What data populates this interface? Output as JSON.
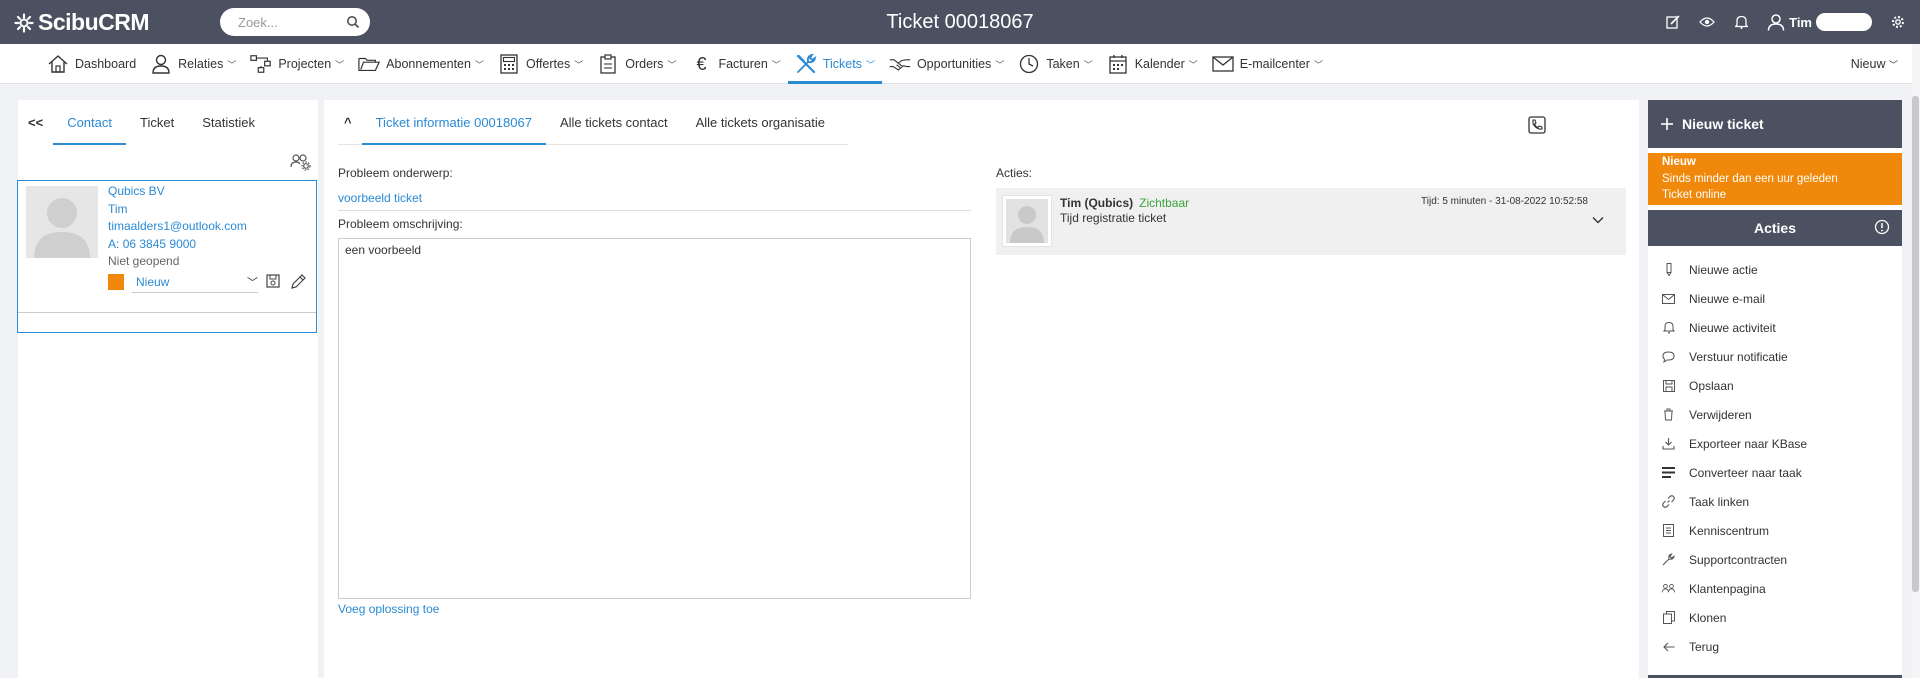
{
  "app": {
    "brand": "ScibuCRM",
    "page_title": "Ticket 00018067"
  },
  "search": {
    "placeholder": "Zoek..."
  },
  "user": {
    "name": "Tim"
  },
  "menu": {
    "items": [
      {
        "label": "Dashboard",
        "icon": "home-icon",
        "dropdown": false
      },
      {
        "label": "Relaties",
        "icon": "person-icon",
        "dropdown": true
      },
      {
        "label": "Projecten",
        "icon": "project-icon",
        "dropdown": true
      },
      {
        "label": "Abonnementen",
        "icon": "folder-icon",
        "dropdown": true
      },
      {
        "label": "Offertes",
        "icon": "calculator-icon",
        "dropdown": true
      },
      {
        "label": "Orders",
        "icon": "clipboard-icon",
        "dropdown": true
      },
      {
        "label": "Facturen",
        "icon": "euro-icon",
        "dropdown": true
      },
      {
        "label": "Tickets",
        "icon": "tools-icon",
        "dropdown": true,
        "active": true
      },
      {
        "label": "Opportunities",
        "icon": "handshake-icon",
        "dropdown": true
      },
      {
        "label": "Taken",
        "icon": "clock-icon",
        "dropdown": true
      },
      {
        "label": "Kalender",
        "icon": "calendar-icon",
        "dropdown": true
      },
      {
        "label": "E-mailcenter",
        "icon": "mail-icon",
        "dropdown": true
      }
    ],
    "nieuw": "Nieuw"
  },
  "left": {
    "back": "<<",
    "tabs": [
      "Contact",
      "Ticket",
      "Statistiek"
    ],
    "contact": {
      "company": "Qubics BV",
      "name": "Tim",
      "email": "timaalders1@outlook.com",
      "phone_prefix": "A:",
      "phone": "06 3845 9000",
      "opened": "Niet geopend",
      "status": "Nieuw",
      "status_color": "#f0890b"
    }
  },
  "middle": {
    "caret": "^",
    "tabs": [
      "Ticket informatie 00018067",
      "Alle tickets contact",
      "Alle tickets organisatie"
    ],
    "subject_label": "Probleem onderwerp:",
    "subject_value": "voorbeeld ticket",
    "description_label": "Probleem omschrijving:",
    "description_value": "een voorbeeld",
    "add_solution": "Voeg oplossing toe",
    "actions_label": "Acties:",
    "action": {
      "author": "Tim (Qubics)",
      "visibility": "Zichtbaar",
      "text": "Tijd registratie ticket",
      "time": "Tijd: 5 minuten - 31-08-2022 10:52:58"
    }
  },
  "right": {
    "new_ticket": "Nieuw ticket",
    "notice": {
      "title": "Nieuw",
      "line1": "Sinds minder dan een uur geleden",
      "line2": "Ticket online",
      "color": "#f0890b"
    },
    "acties_title": "Acties",
    "actions": [
      {
        "label": "Nieuwe actie",
        "icon": "pencil-icon"
      },
      {
        "label": "Nieuwe e-mail",
        "icon": "envelope-icon"
      },
      {
        "label": "Nieuwe activiteit",
        "icon": "bell-icon"
      },
      {
        "label": "Verstuur notificatie",
        "icon": "chat-icon"
      },
      {
        "label": "Opslaan",
        "icon": "save-icon"
      },
      {
        "label": "Verwijderen",
        "icon": "trash-icon"
      },
      {
        "label": "Exporteer naar KBase",
        "icon": "export-icon"
      },
      {
        "label": "Converteer naar taak",
        "icon": "convert-icon"
      },
      {
        "label": "Taak linken",
        "icon": "link-icon"
      },
      {
        "label": "Kenniscentrum",
        "icon": "book-icon"
      },
      {
        "label": "Supportcontracten",
        "icon": "wrench-icon"
      },
      {
        "label": "Klantenpagina",
        "icon": "group-icon"
      },
      {
        "label": "Klonen",
        "icon": "copy-icon"
      },
      {
        "label": "Terug",
        "icon": "arrow-left-icon"
      }
    ]
  },
  "colors": {
    "header": "#4b5161",
    "accent": "#2a8ad4",
    "orange": "#f0890b",
    "green": "#3aa33a"
  }
}
